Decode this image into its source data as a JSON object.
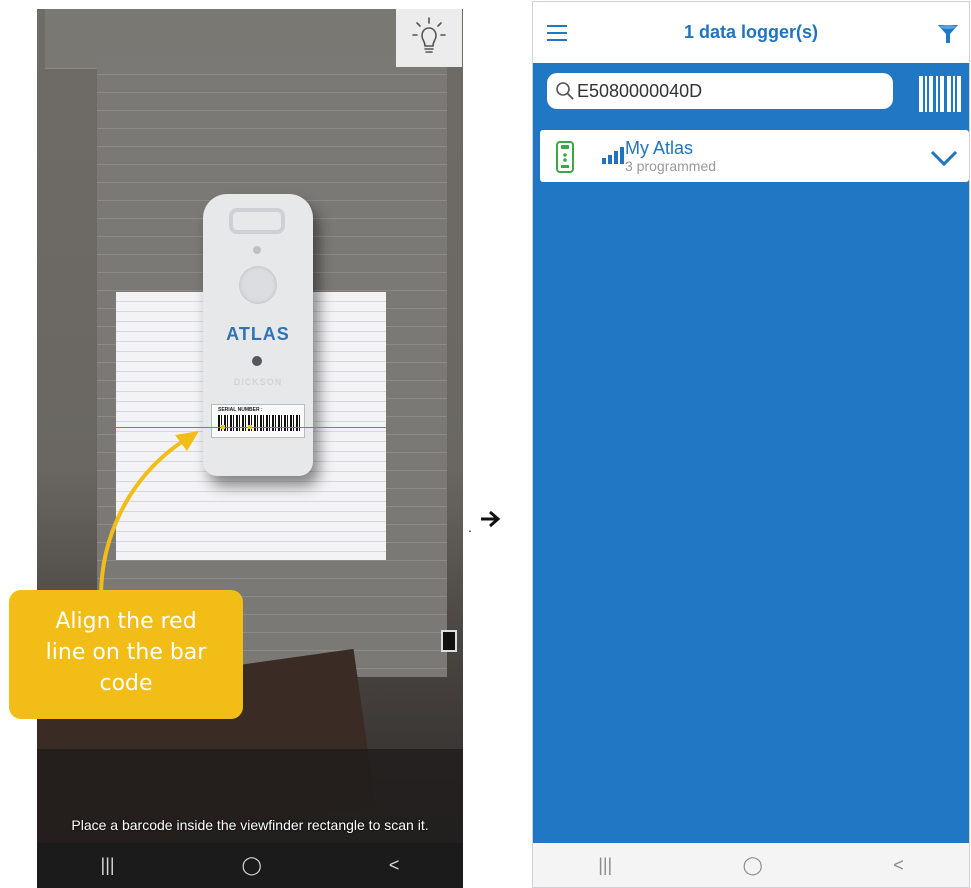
{
  "scanner": {
    "device_brand": "ATLAS",
    "device_maker": "DICKSON",
    "serial_label": "SERIAL NUMBER :",
    "annotation_lines": [
      "Align the red",
      "line on the bar",
      "code"
    ],
    "instruction": "Place a barcode inside the viewfinder rectangle to scan it.",
    "nav": {
      "recents": "|||",
      "home": "◯",
      "back": "<"
    }
  },
  "transition": {
    "dot": ".",
    "arrow_icon": "right-arrow-icon"
  },
  "app": {
    "title": "1 data logger(s)",
    "search": {
      "value": "E5080000040D",
      "placeholder": ""
    },
    "loggers": [
      {
        "name": "My Atlas",
        "status": "3 programmed",
        "icon": "data-logger-icon"
      }
    ],
    "nav": {
      "recents": "|||",
      "home": "◯",
      "back": "<"
    }
  },
  "colors": {
    "brand_blue": "#2077c4",
    "highlight_yellow": "#f2bd16",
    "logger_green": "#3aa845"
  }
}
